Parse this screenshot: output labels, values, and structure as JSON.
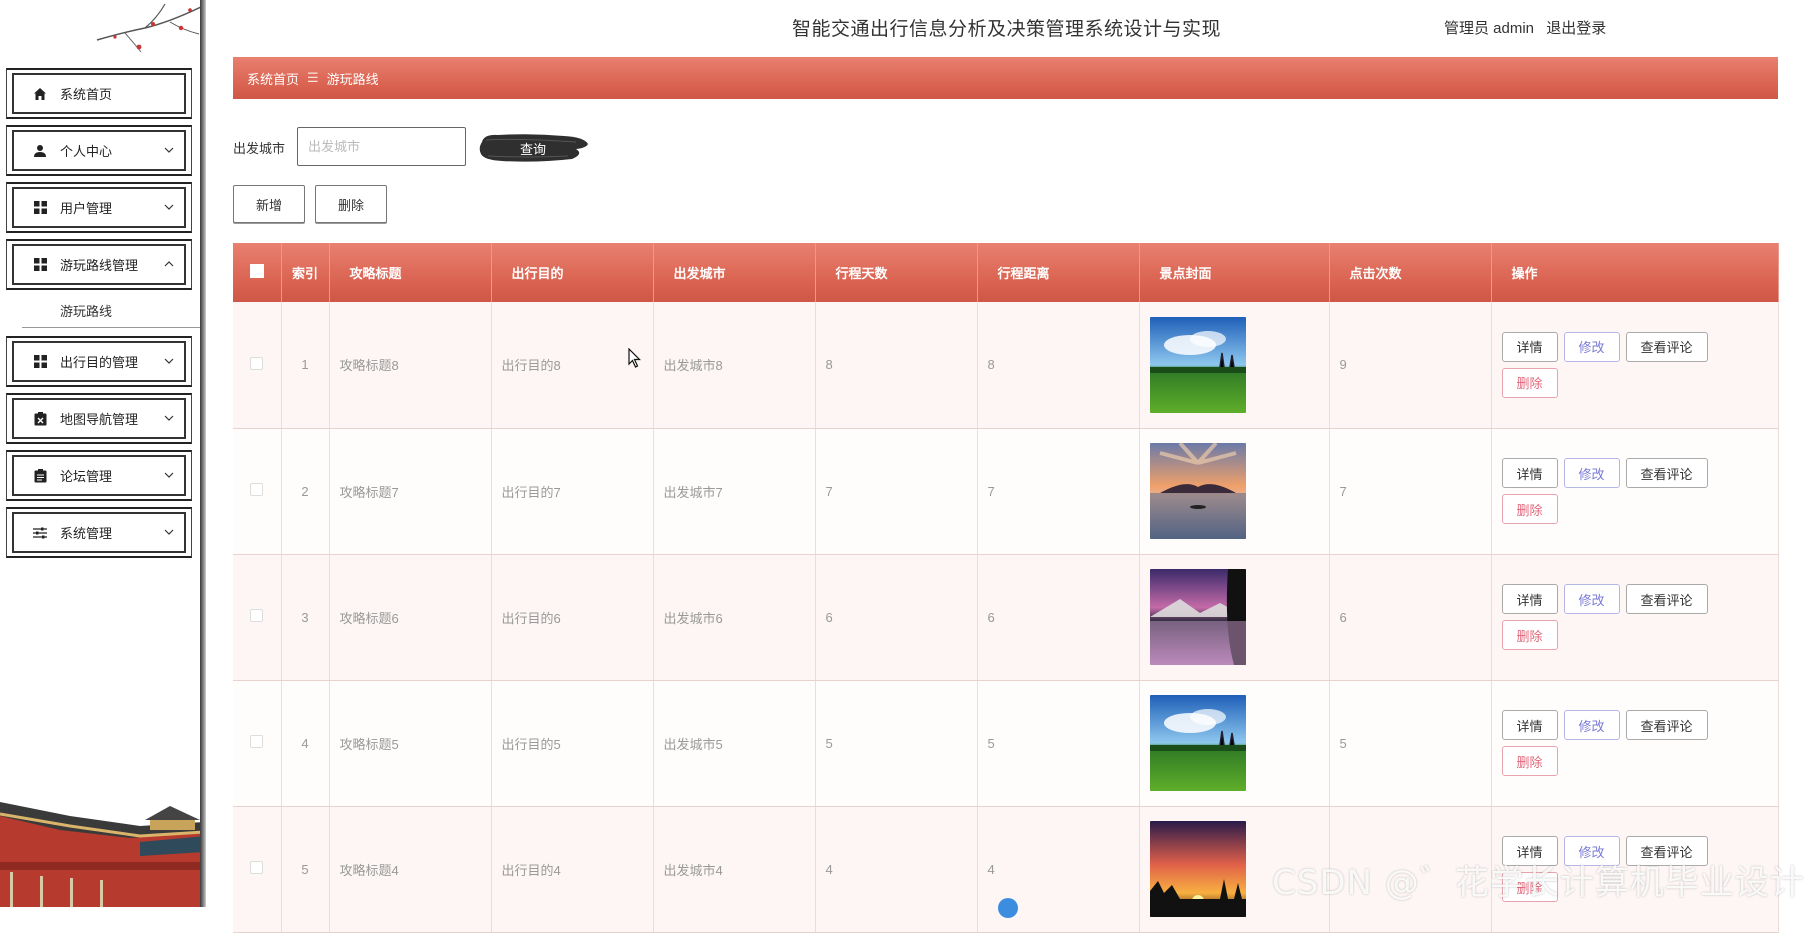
{
  "header": {
    "title": "智能交通出行信息分析及决策管理系统设计与实现",
    "user_role": "管理员 admin",
    "logout": "退出登录"
  },
  "sidebar": {
    "items": [
      {
        "label": "系统首页",
        "icon": "home-icon"
      },
      {
        "label": "个人中心",
        "icon": "user-icon"
      },
      {
        "label": "用户管理",
        "icon": "grid-icon"
      },
      {
        "label": "游玩路线管理",
        "icon": "grid-icon",
        "expanded": true
      },
      {
        "label": "出行目的管理",
        "icon": "grid-icon"
      },
      {
        "label": "地图导航管理",
        "icon": "clipboard-x-icon"
      },
      {
        "label": "论坛管理",
        "icon": "clipboard-icon"
      },
      {
        "label": "系统管理",
        "icon": "sliders-icon"
      }
    ],
    "submenu": [
      "游玩路线"
    ]
  },
  "breadcrumb": {
    "home": "系统首页",
    "separator": "☰",
    "current": "游玩路线"
  },
  "search": {
    "label": "出发城市",
    "placeholder": "出发城市",
    "button": "查询"
  },
  "actions": {
    "add": "新增",
    "delete": "删除"
  },
  "table": {
    "columns": [
      "索引",
      "攻略标题",
      "出行目的",
      "出发城市",
      "行程天数",
      "行程距离",
      "景点封面",
      "点击次数",
      "操作"
    ],
    "rows": [
      {
        "index": "1",
        "title": "攻略标题8",
        "purpose": "出行目的8",
        "city": "出发城市8",
        "days": "8",
        "distance": "8",
        "cover": "meadow",
        "clicks": "9"
      },
      {
        "index": "2",
        "title": "攻略标题7",
        "purpose": "出行目的7",
        "city": "出发城市7",
        "days": "7",
        "distance": "7",
        "cover": "lake-sunset",
        "clicks": "7"
      },
      {
        "index": "3",
        "title": "攻略标题6",
        "purpose": "出行目的6",
        "city": "出发城市6",
        "days": "6",
        "distance": "6",
        "cover": "mountain-lake",
        "clicks": "6"
      },
      {
        "index": "4",
        "title": "攻略标题5",
        "purpose": "出行目的5",
        "city": "出发城市5",
        "days": "5",
        "distance": "5",
        "cover": "meadow",
        "clicks": "5"
      },
      {
        "index": "5",
        "title": "攻略标题4",
        "purpose": "出行目的4",
        "city": "出发城市4",
        "days": "4",
        "distance": "4",
        "cover": "sunset-trees",
        "clicks": ""
      }
    ],
    "ops": {
      "detail": "详情",
      "edit": "修改",
      "comments": "查看评论",
      "delete": "删除"
    }
  },
  "watermark": "CSDN @゛花学长计算机毕业设计",
  "colors": {
    "accent": "#d9614f",
    "edit": "#7b7bd6",
    "danger": "#e0677a"
  }
}
